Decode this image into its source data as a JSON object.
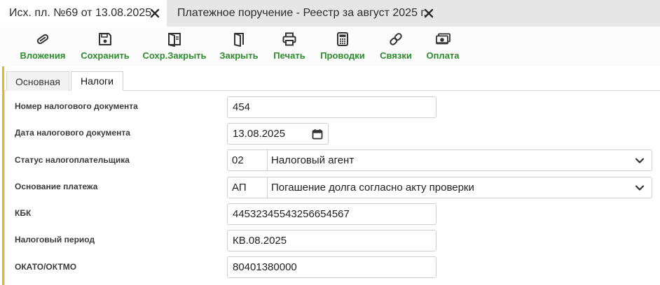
{
  "tabs": [
    {
      "label": "Исх. пл. №69 от 13.08.2025",
      "active": true
    },
    {
      "label": "Платежное поручение - Реестр за август 2025 г.",
      "active": false
    }
  ],
  "toolbar": {
    "attachments": "Вложения",
    "save": "Сохранить",
    "save_close": "Сохр.Закрыть",
    "close": "Закрыть",
    "print": "Печать",
    "postings": "Проводки",
    "links": "Связки",
    "payment": "Оплата"
  },
  "inner_tabs": [
    {
      "label": "Основная",
      "active": false
    },
    {
      "label": "Налоги",
      "active": true
    }
  ],
  "form": {
    "tax_doc_number": {
      "label": "Номер налогового документа",
      "value": "454"
    },
    "tax_doc_date": {
      "label": "Дата налогового документа",
      "value": "13.08.2025"
    },
    "taxpayer_status": {
      "label": "Статус налогоплательщика",
      "code": "02",
      "value": "Налоговый агент"
    },
    "payment_basis": {
      "label": "Основание платежа",
      "code": "АП",
      "value": "Погашение долга согласно акту проверки"
    },
    "kbk": {
      "label": "КБК",
      "value": "44532345543256654567"
    },
    "tax_period": {
      "label": "Налоговый период",
      "value": "КВ.08.2025"
    },
    "okato": {
      "label": "ОКАТО/ОКТМО",
      "value": "80401380000"
    }
  },
  "colors": {
    "toolbar_label": "#2e8b2e",
    "accent_bar": "#e9b429",
    "tabbar_bg": "#e6e6e6"
  }
}
